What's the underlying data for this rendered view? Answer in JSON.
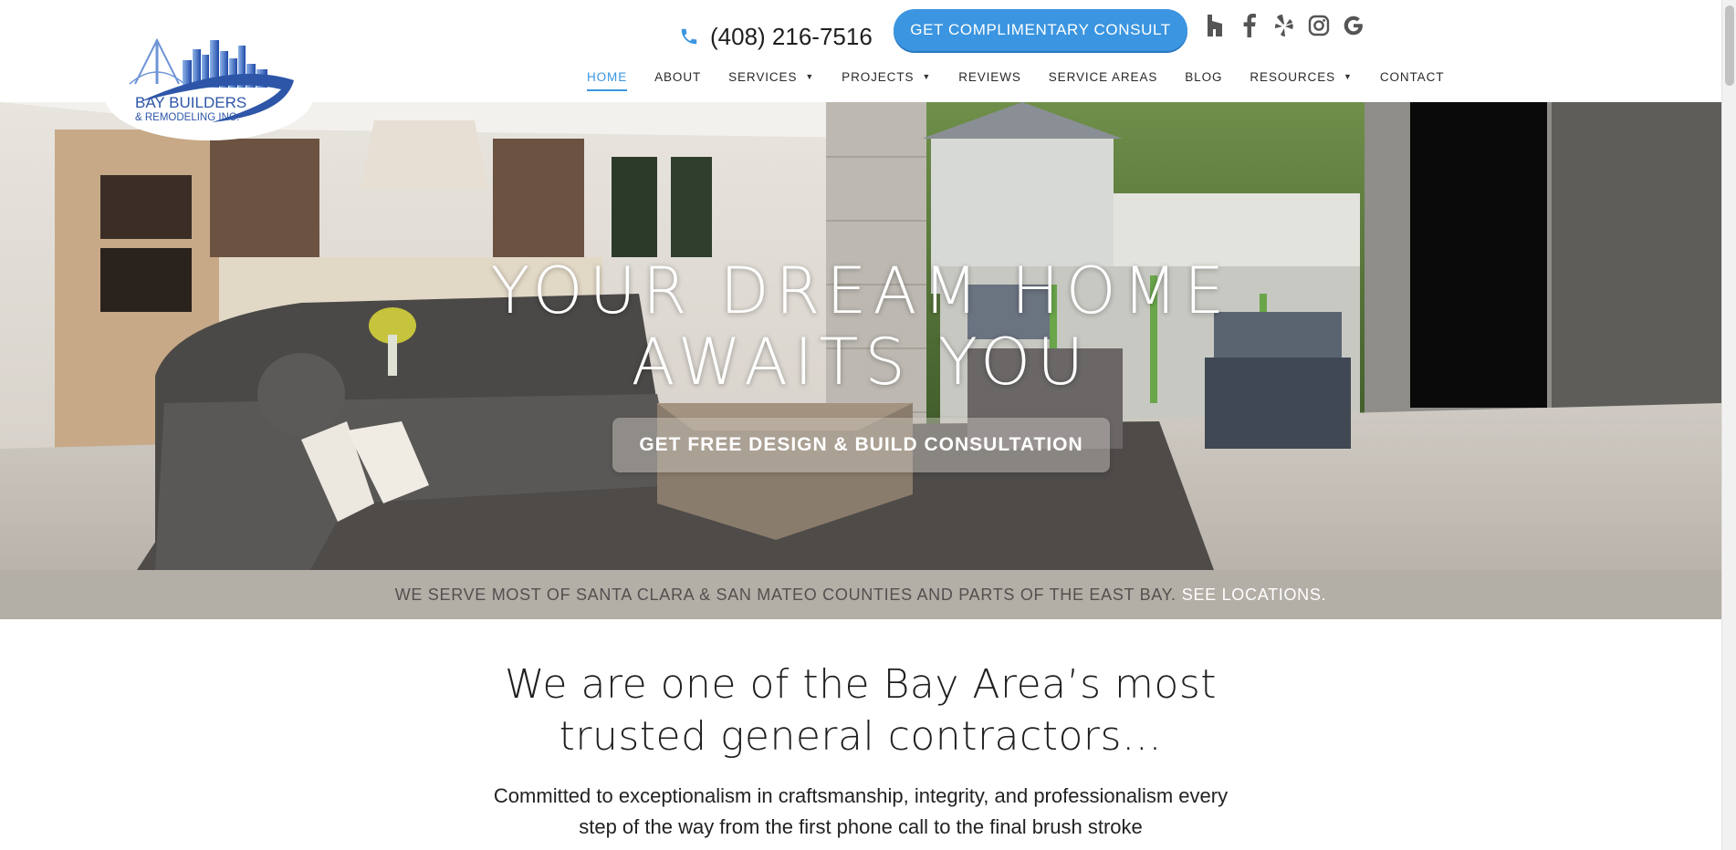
{
  "header": {
    "logo": {
      "line1": "BAY BUILDERS",
      "line2": "& REMODELING INC."
    },
    "phone": "(408) 216-7516",
    "cta_label": "GET COMPLIMENTARY CONSULT",
    "social": [
      "houzz-icon",
      "facebook-icon",
      "yelp-icon",
      "instagram-icon",
      "google-icon"
    ],
    "nav": [
      {
        "label": "HOME",
        "active": true,
        "dropdown": false
      },
      {
        "label": "ABOUT",
        "dropdown": false
      },
      {
        "label": "SERVICES",
        "dropdown": true
      },
      {
        "label": "PROJECTS",
        "dropdown": true
      },
      {
        "label": "REVIEWS",
        "dropdown": false
      },
      {
        "label": "SERVICE AREAS",
        "dropdown": false
      },
      {
        "label": "BLOG",
        "dropdown": false
      },
      {
        "label": "RESOURCES",
        "dropdown": true
      },
      {
        "label": "CONTACT",
        "dropdown": false
      }
    ]
  },
  "hero": {
    "title_line1": "YOUR DREAM HOME",
    "title_line2": "AWAITS YOU",
    "cta_label": "GET FREE DESIGN & BUILD CONSULTATION"
  },
  "band": {
    "text": "WE SERVE MOST OF SANTA CLARA & SAN MATEO COUNTIES AND PARTS OF THE EAST BAY.",
    "link": "SEE LOCATIONS."
  },
  "intro": {
    "title_line1": "We are one of the Bay Area’s most",
    "title_line2": "trusted general contractors…",
    "text_line1": "Committed to exceptionalism in craftsmanship, integrity, and professionalism every",
    "text_line2": "step of the way from the first phone call to the final brush stroke"
  },
  "colors": {
    "accent": "#3b95e0",
    "band": "#b3aea6",
    "logo_blue": "#2d56a8"
  }
}
